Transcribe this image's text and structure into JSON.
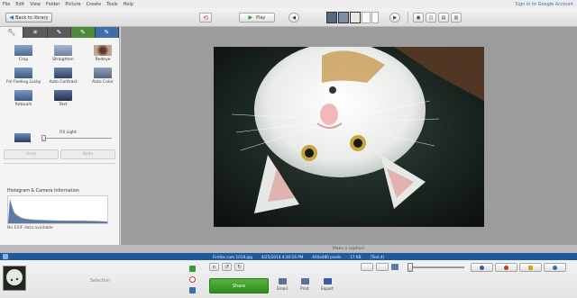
{
  "menu": {
    "items": [
      "File",
      "Edit",
      "View",
      "Folder",
      "Picture",
      "Create",
      "Tools",
      "Help"
    ],
    "sign_in": "Sign in to Google Account"
  },
  "toolbar": {
    "back_label": "Back to library",
    "play_label": "Play"
  },
  "left_panel": {
    "tabs": [
      {
        "icon": "wrench-icon"
      },
      {
        "icon": "tuning-icon"
      },
      {
        "icon": "brush-icon"
      },
      {
        "icon": "effects-brush-icon"
      },
      {
        "icon": "more-effects-brush-icon"
      }
    ],
    "tools": [
      {
        "label": "Crop",
        "color": "#7a8fb0"
      },
      {
        "label": "Straighten",
        "color": "#9aa7c2"
      },
      {
        "label": "Redeye",
        "color": "#a89078"
      },
      {
        "label": "I'm Feeling Lucky",
        "color": "#6c86ad"
      },
      {
        "label": "Auto Contrast",
        "color": "#5a6f8f"
      },
      {
        "label": "Auto Color",
        "color": "#7d8ea6"
      },
      {
        "label": "Retouch",
        "color": "#5f7ea6"
      },
      {
        "label": "Text",
        "color": "#3f5578"
      }
    ],
    "fill_light_label": "Fill Light",
    "fill_light_value": 0,
    "undo_label": "Undo",
    "redo_label": "Redo",
    "histogram_title": "Histogram & Camera Information",
    "exif_text": "No EXIF data available"
  },
  "status": {
    "caption": "Make a caption!",
    "info": [
      "Firefox.com 1018.jpg",
      "4/25/2014 4:30:16 PM",
      "640x480 pixels",
      "17 KB",
      "(Text 4)"
    ]
  },
  "tray": {
    "selection_label": "Selection",
    "share_label": "Share",
    "actions": [
      {
        "label": "Email",
        "icon": "email-icon",
        "color": "#5a6f9a"
      },
      {
        "label": "Print",
        "icon": "print-icon",
        "color": "#5a6f9a"
      },
      {
        "label": "Export",
        "icon": "export-icon",
        "color": "#3a5a9a"
      }
    ]
  },
  "colors": {
    "share_green": "#3b9b28",
    "info_blue": "#1f5a9e"
  }
}
